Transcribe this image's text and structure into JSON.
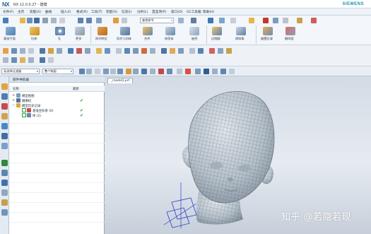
{
  "app": {
    "logo": "NX",
    "title": "NX 12.0.0.27 - 建模",
    "brand": "SIEMENS"
  },
  "menu": {
    "items": [
      "文件(F)",
      "主页",
      "装配(A)",
      "曲线",
      "插入(I)",
      "格式(R)",
      "工具(T)",
      "装配(A)",
      "信息(I)",
      "分析(L)",
      "首选项(P)",
      "窗口(O)",
      "GC工具箱",
      "帮助(H)"
    ]
  },
  "ribbon": {
    "groups": [
      {
        "label": "基准平面"
      },
      {
        "label": "拉伸"
      },
      {
        "label": "孔"
      },
      {
        "label": "更多"
      },
      {
        "label": "阵列特征"
      },
      {
        "label": "同步几何体"
      },
      {
        "label": "合并"
      },
      {
        "label": "修剪体"
      },
      {
        "label": "抽壳"
      },
      {
        "label": "边倒圆"
      },
      {
        "label": "倒斜角"
      },
      {
        "label": "偏置区域"
      },
      {
        "label": "删除面"
      }
    ],
    "search_placeholder": "查找命令"
  },
  "selection_bar": {
    "filter": "无选择过滤器",
    "scope": "整个装配"
  },
  "navigator": {
    "title": "部件导航器",
    "col_name": "名称",
    "col_latest": "最新",
    "rows": [
      {
        "label": "模型视图",
        "check": ""
      },
      {
        "label": "摄像机",
        "check": "✔"
      },
      {
        "label": "模型历史记录",
        "check": ""
      },
      {
        "label": "基准坐标系 (0)",
        "check": "✔"
      },
      {
        "label": "体 (2)",
        "check": "✔"
      }
    ]
  },
  "viewport": {
    "tab": "_model1.prt",
    "watermark": "知乎 @若隐若现"
  },
  "colors": {
    "accent": "#2a5f9e",
    "brand": "#1a8fb0",
    "model": "#b9c3cc",
    "mesh": "#3d4a56",
    "check": "#1f9a2d"
  }
}
